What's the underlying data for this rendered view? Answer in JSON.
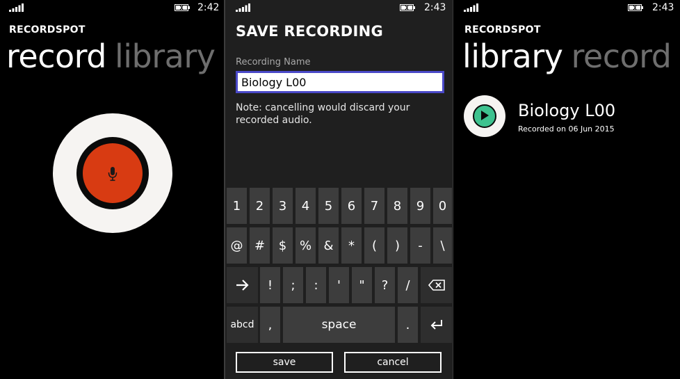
{
  "screens": [
    {
      "status": {
        "time": "2:42"
      },
      "app_name": "RECORDSPOT",
      "pivot": {
        "active": "record",
        "inactive": "library"
      }
    },
    {
      "status": {
        "time": "2:43"
      },
      "title": "SAVE RECORDING",
      "field_label": "Recording Name",
      "field_value": "Biology L00",
      "note": "Note: cancelling would discard your recorded audio.",
      "keyboard": {
        "row1": [
          "1",
          "2",
          "3",
          "4",
          "5",
          "6",
          "7",
          "8",
          "9",
          "0"
        ],
        "row2": [
          "@",
          "#",
          "$",
          "%",
          "&",
          "*",
          "(",
          ")",
          "-",
          "\\"
        ],
        "row3": [
          "!",
          ";",
          ":",
          "'",
          "\"",
          "?",
          "/"
        ],
        "abc": "abcd",
        "comma": ",",
        "space": "space",
        "period": "."
      },
      "buttons": {
        "save": "save",
        "cancel": "cancel"
      }
    },
    {
      "status": {
        "time": "2:43"
      },
      "app_name": "RECORDSPOT",
      "pivot": {
        "active": "library",
        "inactive": "record"
      },
      "items": [
        {
          "title": "Biology L00",
          "subtitle": "Recorded on 06 Jun 2015"
        }
      ]
    }
  ],
  "colors": {
    "record_red": "#d83b12",
    "play_green": "#3ec28f",
    "input_border": "#4a49c8",
    "pivot_inactive": "#6e6e6e"
  },
  "icons": [
    "signal-icon",
    "battery-icon",
    "microphone-icon",
    "play-icon",
    "arrow-right-icon",
    "backspace-icon",
    "enter-icon"
  ]
}
